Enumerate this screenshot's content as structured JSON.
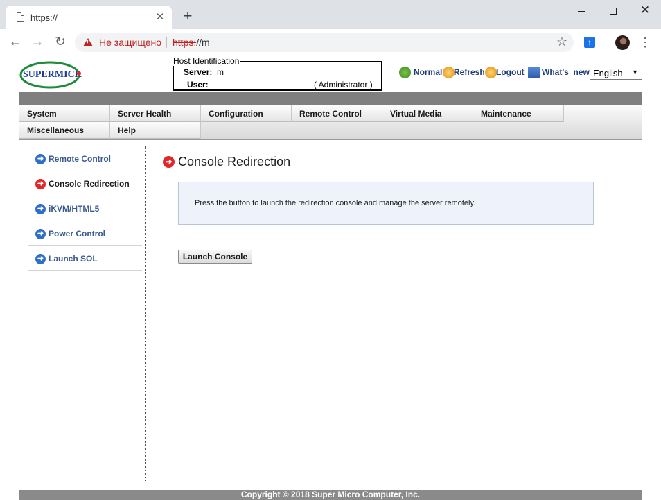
{
  "browser": {
    "tab_title": "https://",
    "not_secure_text": "Не защищено",
    "url_scheme": "https:",
    "url_rest": "//m"
  },
  "host": {
    "legend": "Host Identification",
    "server_label": "Server:",
    "server_value": "m",
    "user_label": "User:",
    "user_value": "( Administrator )"
  },
  "top_links": {
    "status": "Normal",
    "refresh": "Refresh",
    "logout": "Logout",
    "whats_new": "What's_new"
  },
  "language": {
    "selected": "English"
  },
  "menu": {
    "row1": [
      "System",
      "Server Health",
      "Configuration",
      "Remote Control",
      "Virtual Media",
      "Maintenance"
    ],
    "row2": [
      "Miscellaneous",
      "Help"
    ]
  },
  "sidebar": {
    "items": [
      {
        "label": "Remote Control",
        "active": false
      },
      {
        "label": "Console Redirection",
        "active": true
      },
      {
        "label": "iKVM/HTML5",
        "active": false
      },
      {
        "label": "Power Control",
        "active": false
      },
      {
        "label": "Launch SOL",
        "active": false
      }
    ]
  },
  "content": {
    "title": "Console Redirection",
    "info": "Press the button to launch the redirection console and manage the server remotely.",
    "launch_button": "Launch Console"
  },
  "footer": {
    "copyright": "Copyright © 2018 Super Micro Computer, Inc."
  },
  "logo": {
    "text": "SUPERMICRO"
  },
  "colors": {
    "link_blue": "#1c3c78",
    "active_red": "#e3262a",
    "arrow_blue": "#2f6fc9",
    "not_secure_red": "#c5221f"
  }
}
